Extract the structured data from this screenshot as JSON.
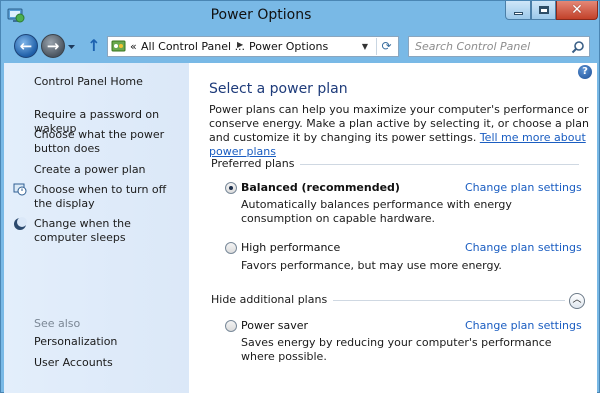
{
  "window": {
    "title": "Power Options"
  },
  "nav": {
    "breadcrumbs": [
      "All Control Panel ...",
      "Power Options"
    ],
    "prefix": "«",
    "search_placeholder": "Search Control Panel"
  },
  "sidebar": {
    "items": [
      {
        "label": "Control Panel Home"
      },
      {
        "label": "Require a password on wakeup"
      },
      {
        "label": "Choose what the power button does"
      },
      {
        "label": "Create a power plan"
      },
      {
        "label": "Choose when to turn off the display"
      },
      {
        "label": "Change when the computer sleeps"
      }
    ],
    "see_also_title": "See also",
    "see_also": [
      {
        "label": "Personalization"
      },
      {
        "label": "User Accounts"
      }
    ]
  },
  "main": {
    "heading": "Select a power plan",
    "intro": "Power plans can help you maximize your computer's performance or conserve energy. Make a plan active by selecting it, or choose a plan and customize it by changing its power settings.",
    "intro_link": "Tell me more about power plans",
    "preferred_label": "Preferred plans",
    "hide_label": "Hide additional plans",
    "change_label": "Change plan settings",
    "plans": [
      {
        "name": "Balanced (recommended)",
        "selected": true,
        "description": "Automatically balances performance with energy consumption on capable hardware."
      },
      {
        "name": "High performance",
        "selected": false,
        "description": "Favors performance, but may use more energy."
      },
      {
        "name": "Power saver",
        "selected": false,
        "description": "Saves energy by reducing your computer's performance where possible."
      }
    ]
  },
  "colors": {
    "accent_link": "#1a5dc1",
    "heading": "#1e3b7a",
    "frame": "#79b9e6"
  }
}
